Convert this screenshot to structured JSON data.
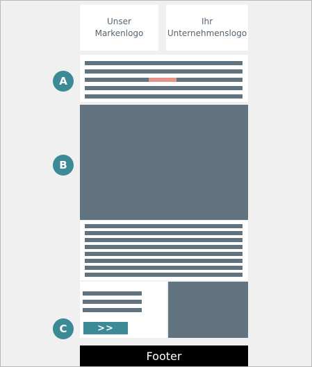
{
  "header": {
    "logo_left": "Unser Markenlogo",
    "logo_left_line1": "Unser",
    "logo_left_line2": "Markenlogo",
    "logo_right_line1": "Ihr",
    "logo_right_line2": "Unternehmenslogo"
  },
  "markers": {
    "a": "A",
    "b": "B",
    "c": "C"
  },
  "cta": {
    "label": ">>"
  },
  "footer": {
    "label": "Footer"
  },
  "colors": {
    "accent": "#3b8a95",
    "placeholder_grey": "#627380",
    "highlight": "#e3938a",
    "background": "#f0f0f0",
    "footer_bg": "#000000"
  }
}
